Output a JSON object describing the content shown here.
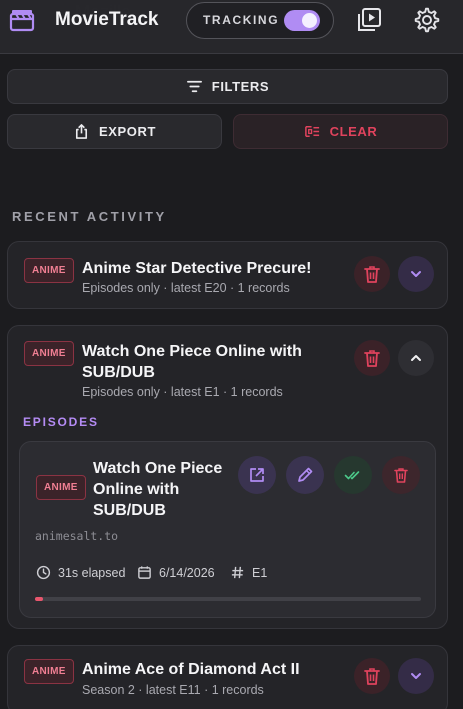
{
  "header": {
    "app_title": "MovieTrack",
    "tracking_label": "TRACKING",
    "tracking_on": true
  },
  "toolbar": {
    "filters_label": "FILTERS",
    "export_label": "EXPORT",
    "clear_label": "CLEAR"
  },
  "recent_activity": {
    "title": "RECENT ACTIVITY",
    "items": [
      {
        "badge": "ANIME",
        "title": "Anime Star Detective Precure!",
        "subtitle": "Episodes only · latest E20 · 1 records",
        "expanded": false
      },
      {
        "badge": "ANIME",
        "title": "Watch One Piece Online with SUB/DUB",
        "subtitle": "Episodes only · latest E1 · 1 records",
        "expanded": true,
        "episodes_title": "EPISODES",
        "episode": {
          "badge": "ANIME",
          "title": "Watch One Piece Online with SUB/DUB",
          "domain": "animesalt.to",
          "elapsed": "31s elapsed",
          "date": "6/14/2026",
          "episode": "E1",
          "progress": 0.02
        }
      },
      {
        "badge": "ANIME",
        "title": "Anime Ace of Diamond Act II",
        "subtitle": "Season 2 · latest E11 · 1 records",
        "expanded": false
      }
    ]
  },
  "colors": {
    "accent_purple": "#b08cf3",
    "danger_red": "#e0435d",
    "success_green": "#4cc98a",
    "background": "#1c1c1f"
  },
  "icons": {
    "logo": "clapperboard-icon",
    "play_library": "play-library-icon",
    "settings": "gear-icon",
    "filters": "filter-lines-icon",
    "export": "share-export-icon",
    "clear": "clear-list-icon",
    "delete": "trash-icon",
    "expand": "chevron-down-icon",
    "collapse": "chevron-up-icon",
    "open": "external-link-icon",
    "edit": "pencil-icon",
    "mark_watched": "double-check-icon",
    "clock": "clock-icon",
    "calendar": "calendar-icon",
    "hash": "hash-icon"
  }
}
